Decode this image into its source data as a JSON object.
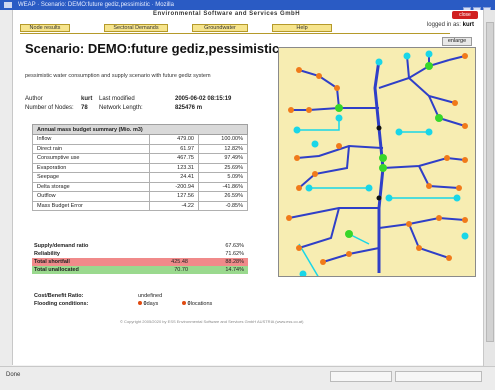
{
  "window": {
    "title": "WEAP · Scenario: DEMO:future gediz,pessimistic · Mozilla",
    "close_label": "close"
  },
  "app": {
    "title": "Environmental Software and Services GmbH",
    "logged_in_label": "logged in as:",
    "user": "kurt"
  },
  "tabs": [
    {
      "label": "Node results"
    },
    {
      "label": "Sectoral Demands"
    },
    {
      "label": "Groundwater"
    },
    {
      "label": "Help"
    }
  ],
  "enlarge_label": "enlarge",
  "scenario": {
    "title": "Scenario: DEMO:future gediz,pessimistic",
    "description": "pessimistic water consumption and supply scenario with future gediz system",
    "author_label": "Author",
    "author": "kurt",
    "modified_label": "Last modified",
    "modified": "2005-06-02 08:15:19",
    "nodes_label": "Number of Nodes:",
    "nodes": "78",
    "length_label": "Network Length:",
    "length": "825476 m"
  },
  "budget": {
    "header": "Annual mass budget summary (Mio. m3)",
    "rows": [
      {
        "label": "Inflow",
        "value": "479.00",
        "pct": "100.00%"
      },
      {
        "label": "Direct rain",
        "value": "61.97",
        "pct": "12.82%"
      },
      {
        "label": "Consumptive use",
        "value": "467.75",
        "pct": "97.49%"
      },
      {
        "label": "Evaporation",
        "value": "123.31",
        "pct": "25.69%"
      },
      {
        "label": "Seepage",
        "value": "24.41",
        "pct": "5.09%"
      },
      {
        "label": "Delta storage",
        "value": "-200.94",
        "pct": "-41.86%"
      },
      {
        "label": "Outflow",
        "value": "127.56",
        "pct": "26.59%"
      },
      {
        "label": "Mass Budget Error",
        "value": "-4.22",
        "pct": "-0.85%"
      }
    ]
  },
  "summary": [
    {
      "label": "Supply/demand ratio",
      "value": "",
      "pct": "67.63%",
      "style": ""
    },
    {
      "label": "Reliability",
      "value": "",
      "pct": "71.62%",
      "style": ""
    },
    {
      "label": "Total shortfall",
      "value": "425.48",
      "pct": "88.28%",
      "style": "red"
    },
    {
      "label": "Total unallocated",
      "value": "70.70",
      "pct": "14.74%",
      "style": "green"
    }
  ],
  "cost": {
    "label": "Cost/Benefit Ratio:",
    "value": "undefined",
    "flooding_label": "Flooding conditions:",
    "days_value": "0",
    "days_label": "days",
    "loc_value": "0",
    "loc_label": "locations"
  },
  "footer": "© Copyright 2005/2020 by  ESS  Environmental Software and Services GmbH AUSTRIA (www.ess.co.at)",
  "status": {
    "text": "Done"
  },
  "colors": {
    "tab_bg": "#f6e48c",
    "map_bg": "#f7edb2",
    "river": "#2f3fc8",
    "node_orange": "#f07a1a",
    "node_cyan": "#19d6e8",
    "node_green": "#38d62a",
    "shortfall": "#f08a8a",
    "unallocated": "#9ad98e"
  }
}
